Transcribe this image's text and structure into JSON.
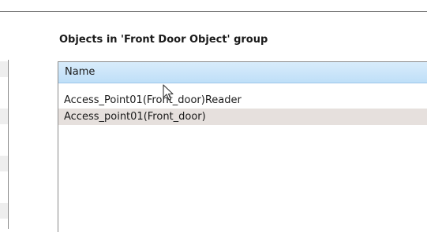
{
  "group_panel": {
    "title": "Objects in 'Front Door Object' group",
    "column_header": "Name",
    "rows": [
      {
        "label": "Access_Point01(Front_door)Reader",
        "selected": false
      },
      {
        "label": "Access_point01(Front_door)",
        "selected": true
      }
    ]
  },
  "cursor_icon": "arrow-pointer-icon"
}
